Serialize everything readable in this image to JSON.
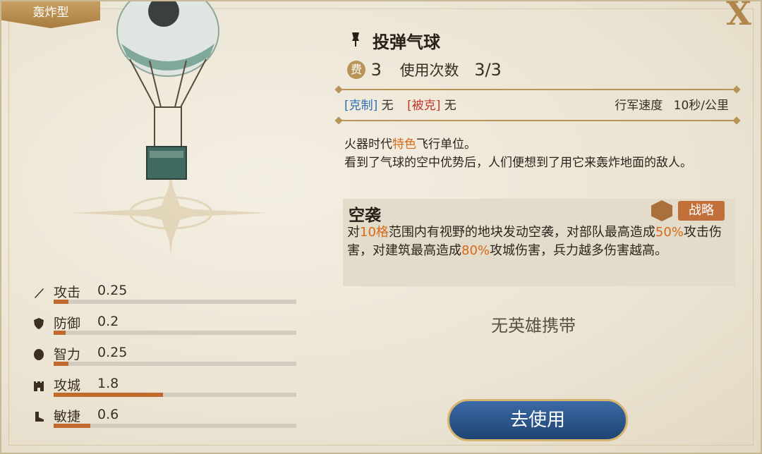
{
  "type_tag": "轰炸型",
  "close_label": "X",
  "unit": {
    "name": "投弹气球",
    "cost_badge": "费",
    "cost": "3",
    "uses_label": "使用次数",
    "uses": "3/3"
  },
  "counters": {
    "counter_label": "[克制]",
    "counter_value": "无",
    "countered_label": "[被克]",
    "countered_value": "无",
    "speed_label": "行军速度",
    "speed_value": "10秒/公里"
  },
  "description": {
    "line1_pre": "火器时代",
    "line1_highlight": "特色",
    "line1_post": "飞行单位。",
    "line2": "看到了气球的空中优势后，人们便想到了用它来轰炸地面的敌人。"
  },
  "skill": {
    "title": "空袭",
    "tag": "战略",
    "t1": "对",
    "t2": "10格",
    "t3": "范围内有视野的地块发动空袭，对部队最高造成",
    "t4": "50%",
    "t5": "攻击伤害，对建筑最高造成",
    "t6": "80%",
    "t7": "攻城伤害，兵力越多伤害越高。"
  },
  "no_hero_text": "无英雄携带",
  "use_button": "去使用",
  "stats": [
    {
      "label": "攻击",
      "value": "0.25",
      "level": 0.06,
      "icon": "sword-icon"
    },
    {
      "label": "防御",
      "value": "0.2",
      "level": 0.05,
      "icon": "shield-icon"
    },
    {
      "label": "智力",
      "value": "0.25",
      "level": 0.06,
      "icon": "brain-icon"
    },
    {
      "label": "攻城",
      "value": "1.8",
      "level": 0.45,
      "icon": "castle-icon"
    },
    {
      "label": "敏捷",
      "value": "0.6",
      "level": 0.15,
      "icon": "boot-icon"
    }
  ],
  "colors": {
    "accent": "#c06a2e",
    "highlight": "#d56a1a",
    "button": "#1f4474",
    "counter": "#2f6fb2",
    "countered": "#c0382b"
  }
}
